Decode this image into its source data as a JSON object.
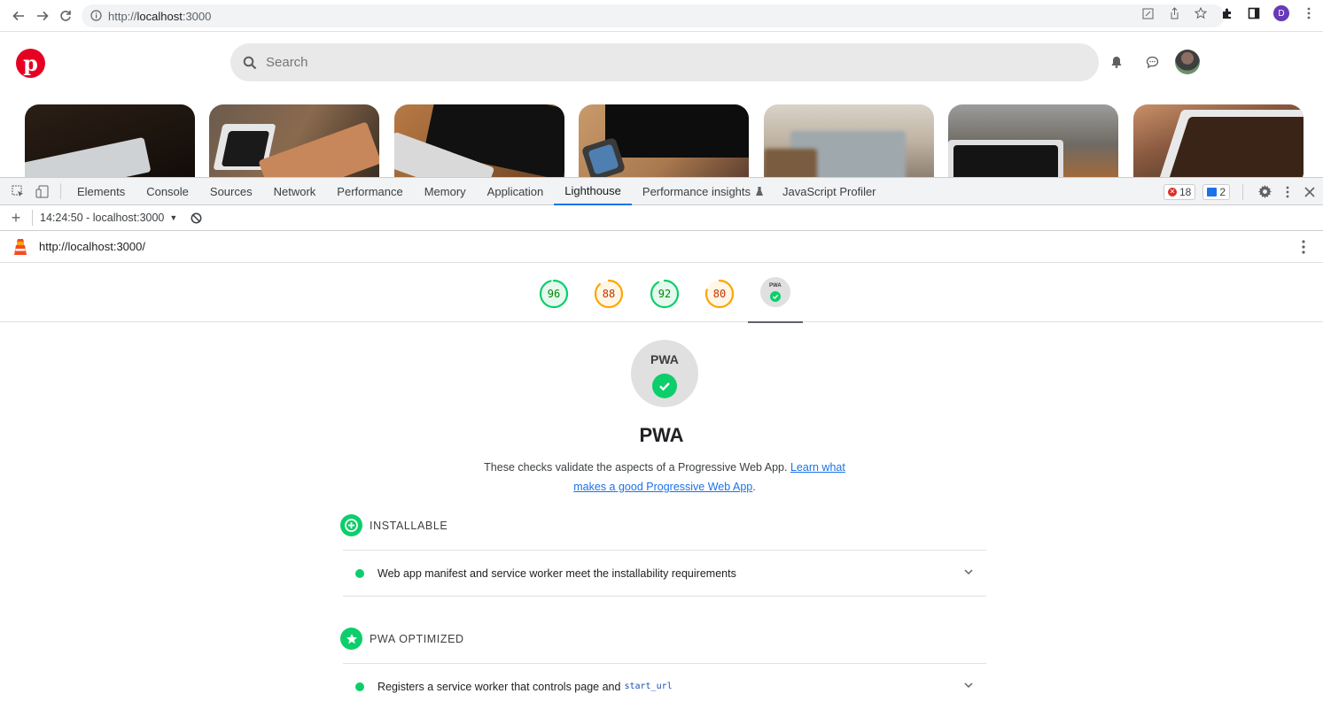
{
  "browser": {
    "url_prefix": "http://",
    "url_host": "localhost",
    "url_suffix": ":3000",
    "profile_initial": "D"
  },
  "pinterest": {
    "logo_letter": "p",
    "search_placeholder": "Search"
  },
  "devtools": {
    "tabs": [
      "Elements",
      "Console",
      "Sources",
      "Network",
      "Performance",
      "Memory",
      "Application",
      "Lighthouse",
      "Performance insights",
      "JavaScript Profiler"
    ],
    "active_tab": "Lighthouse",
    "error_count": "18",
    "message_count": "2",
    "report_selector": "14:24:50 - localhost:3000",
    "report_url": "http://localhost:3000/"
  },
  "lighthouse": {
    "scores": [
      {
        "value": "96",
        "score": 96,
        "color": "#0cce6b",
        "text_color": "#008800",
        "fill": "#e6f9ef"
      },
      {
        "value": "88",
        "score": 88,
        "color": "#ffa400",
        "text_color": "#c33300",
        "fill": "#fff6e6"
      },
      {
        "value": "92",
        "score": 92,
        "color": "#0cce6b",
        "text_color": "#008800",
        "fill": "#e6f9ef"
      },
      {
        "value": "80",
        "score": 80,
        "color": "#ffa400",
        "text_color": "#c33300",
        "fill": "#fff6e6"
      }
    ],
    "pwa_logo_text": "PWA",
    "pwa_title": "PWA",
    "pwa_description": "These checks validate the aspects of a Progressive Web App.",
    "learn_more_link": "Learn what makes a good Progressive Web App",
    "groups": {
      "installable": {
        "title": "INSTALLABLE",
        "audit": "Web app manifest and service worker meet the installability requirements"
      },
      "optimized": {
        "title": "PWA OPTIMIZED",
        "audit": "Registers a service worker that controls page and",
        "audit_code": "start_url"
      }
    }
  }
}
